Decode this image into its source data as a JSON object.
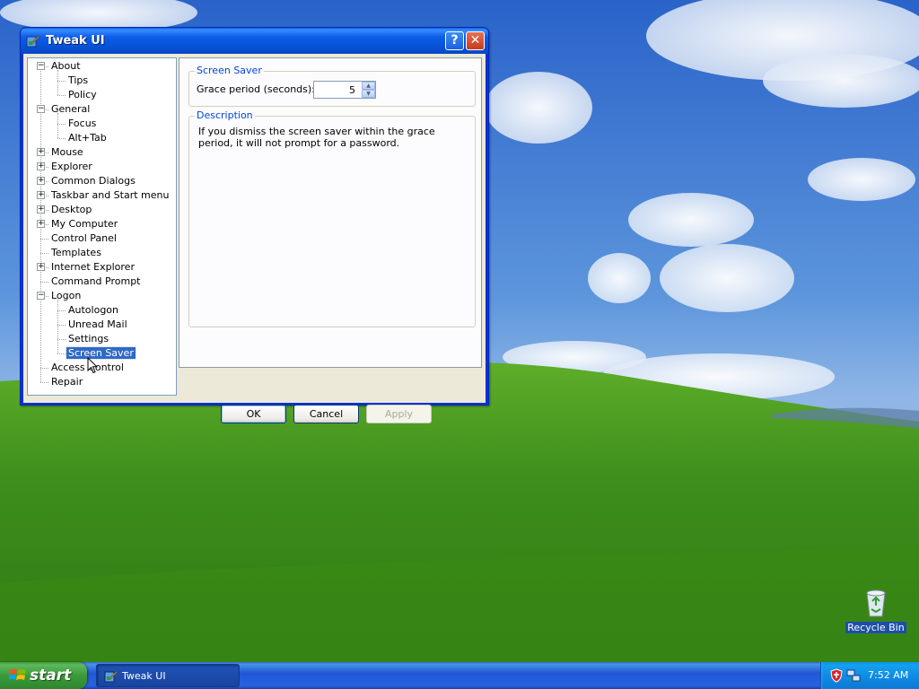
{
  "window": {
    "title": "Tweak UI",
    "help_glyph": "?",
    "close_glyph": "✕"
  },
  "tree": {
    "items": [
      {
        "label": "About",
        "expander": "−"
      },
      {
        "label": "Tips"
      },
      {
        "label": "Policy"
      },
      {
        "label": "General",
        "expander": "−"
      },
      {
        "label": "Focus"
      },
      {
        "label": "Alt+Tab"
      },
      {
        "label": "Mouse",
        "expander": "+"
      },
      {
        "label": "Explorer",
        "expander": "+"
      },
      {
        "label": "Common Dialogs",
        "expander": "+"
      },
      {
        "label": "Taskbar and Start menu",
        "expander": "+"
      },
      {
        "label": "Desktop",
        "expander": "+"
      },
      {
        "label": "My Computer",
        "expander": "+"
      },
      {
        "label": "Control Panel"
      },
      {
        "label": "Templates"
      },
      {
        "label": "Internet Explorer",
        "expander": "+"
      },
      {
        "label": "Command Prompt"
      },
      {
        "label": "Logon",
        "expander": "−"
      },
      {
        "label": "Autologon"
      },
      {
        "label": "Unread Mail"
      },
      {
        "label": "Settings"
      },
      {
        "label": "Screen Saver",
        "selected": true
      },
      {
        "label": "Access Control"
      },
      {
        "label": "Repair"
      }
    ]
  },
  "screen_saver": {
    "group_title": "Screen Saver",
    "grace_label": "Grace period (seconds):",
    "grace_value": "5",
    "spin_up": "▲",
    "spin_down": "▼"
  },
  "description": {
    "group_title": "Description",
    "text": "If you dismiss the screen saver within the grace period, it will not prompt for a password."
  },
  "buttons": {
    "ok": "OK",
    "cancel": "Cancel",
    "apply": "Apply"
  },
  "desktop": {
    "recycle_bin_label": "Recycle Bin"
  },
  "taskbar": {
    "start_label": "start",
    "task_label": "Tweak UI",
    "clock": "7:52 AM"
  },
  "icons": {
    "title": "tweakui-icon",
    "tray": [
      "security-shield-icon",
      "network-icon"
    ]
  },
  "colors": {
    "titlebar": "#0a5fe6",
    "selection": "#316ac5",
    "group_title": "#0046d5",
    "start_button": "#3a9a3a",
    "taskbar": "#2157d7"
  }
}
